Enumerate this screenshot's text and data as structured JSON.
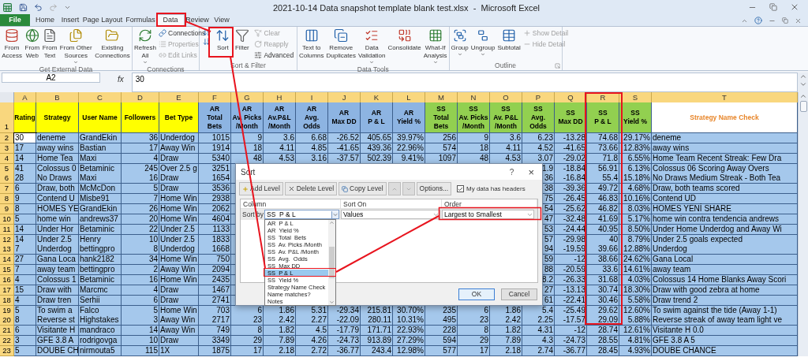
{
  "window": {
    "title": "2021-10-14 Data snapshot template blank test.xlsx  -  Microsoft Excel"
  },
  "tabs": [
    {
      "label": "File",
      "kind": "file",
      "selected": false
    },
    {
      "label": "Home",
      "kind": "tab",
      "selected": false
    },
    {
      "label": "Insert",
      "kind": "tab",
      "selected": false
    },
    {
      "label": "Page Layout",
      "kind": "tab",
      "selected": false
    },
    {
      "label": "Formulas",
      "kind": "tab",
      "selected": false
    },
    {
      "label": "Data",
      "kind": "tab",
      "selected": true
    },
    {
      "label": "Review",
      "kind": "tab",
      "selected": false
    },
    {
      "label": "View",
      "kind": "tab",
      "selected": false
    }
  ],
  "ribbon": {
    "groups": [
      {
        "label": "Get External Data",
        "items": [
          {
            "kind": "large",
            "label": [
              "From",
              "Access"
            ]
          },
          {
            "kind": "large",
            "label": [
              "From",
              "Web"
            ]
          },
          {
            "kind": "large",
            "label": [
              "From",
              "Text"
            ]
          },
          {
            "kind": "large",
            "label": [
              "From Other",
              "Sources"
            ],
            "dropdown": true
          },
          {
            "kind": "large",
            "label": [
              "Existing",
              "Connections"
            ]
          }
        ]
      },
      {
        "label": "Connections",
        "items": [
          {
            "kind": "large",
            "label": [
              "Refresh",
              "All"
            ],
            "dropdown": true
          },
          {
            "kind": "small",
            "label": "Connections",
            "disabled": false
          },
          {
            "kind": "small",
            "label": "Properties",
            "disabled": true
          },
          {
            "kind": "small",
            "label": "Edit Links",
            "disabled": true
          }
        ]
      },
      {
        "label": "Sort & Filter",
        "items": [
          {
            "kind": "icon",
            "disabled": false
          },
          {
            "kind": "icon",
            "disabled": false
          },
          {
            "kind": "large",
            "label": [
              "Sort"
            ]
          },
          {
            "kind": "large",
            "label": [
              "Filter"
            ]
          },
          {
            "kind": "small",
            "label": "Clear",
            "disabled": true
          },
          {
            "kind": "small",
            "label": "Reapply",
            "disabled": true
          },
          {
            "kind": "small",
            "label": "Advanced",
            "disabled": false
          }
        ]
      },
      {
        "label": "Data Tools",
        "items": [
          {
            "kind": "large",
            "label": [
              "Text to",
              "Columns"
            ]
          },
          {
            "kind": "large",
            "label": [
              "Remove",
              "Duplicates"
            ]
          },
          {
            "kind": "large",
            "label": [
              "Data",
              "Validation"
            ],
            "dropdown": true
          },
          {
            "kind": "large",
            "label": [
              "Consolidate"
            ]
          },
          {
            "kind": "large",
            "label": [
              "What-If",
              "Analysis"
            ],
            "dropdown": true
          }
        ]
      },
      {
        "label": "Outline",
        "launcher": true,
        "items": [
          {
            "kind": "large",
            "label": [
              "Group"
            ],
            "dropdown": true
          },
          {
            "kind": "large",
            "label": [
              "Ungroup"
            ],
            "dropdown": true
          },
          {
            "kind": "large",
            "label": [
              "Subtotal"
            ]
          },
          {
            "kind": "small",
            "label": "Show Detail",
            "disabled": true
          },
          {
            "kind": "small",
            "label": "Hide Detail",
            "disabled": true
          }
        ]
      }
    ]
  },
  "formula_bar": {
    "name_box": "A2",
    "fx": "fx",
    "value": "30"
  },
  "sheet": {
    "header_row_number": "1",
    "columns": [
      {
        "letter": "A",
        "header": [
          "Rating"
        ],
        "kind": "label"
      },
      {
        "letter": "B",
        "header": [
          "Strategy"
        ],
        "kind": "label"
      },
      {
        "letter": "C",
        "header": [
          "User Name"
        ],
        "kind": "label"
      },
      {
        "letter": "D",
        "header": [
          "Followers"
        ],
        "kind": "count"
      },
      {
        "letter": "E",
        "header": [
          "Bet Type"
        ],
        "kind": "label"
      },
      {
        "letter": "F",
        "header": [
          "AR",
          "Total",
          "Bets"
        ],
        "kind": "ar"
      },
      {
        "letter": "G",
        "header": [
          "AR",
          "Av. Picks",
          "/Month"
        ],
        "kind": "ar"
      },
      {
        "letter": "H",
        "header": [
          "AR",
          "Av.P&L",
          "/Month"
        ],
        "kind": "ar"
      },
      {
        "letter": "I",
        "header": [
          "AR",
          "Avg.",
          "Odds"
        ],
        "kind": "ar"
      },
      {
        "letter": "J",
        "header": [
          "AR",
          "Max DD"
        ],
        "kind": "ar"
      },
      {
        "letter": "K",
        "header": [
          "AR",
          "P & L"
        ],
        "kind": "ar"
      },
      {
        "letter": "L",
        "header": [
          "AR",
          "Yield %"
        ],
        "kind": "ar"
      },
      {
        "letter": "M",
        "header": [
          "SS",
          "Total",
          "Bets"
        ],
        "kind": "ss"
      },
      {
        "letter": "N",
        "header": [
          "SS",
          "Av. Picks",
          "/Month"
        ],
        "kind": "ss"
      },
      {
        "letter": "O",
        "header": [
          "SS",
          "Av. P&L",
          "/Month"
        ],
        "kind": "ss"
      },
      {
        "letter": "P",
        "header": [
          "SS",
          "Avg.",
          "Odds"
        ],
        "kind": "ss"
      },
      {
        "letter": "Q",
        "header": [
          "SS",
          "Max DD"
        ],
        "kind": "ss"
      },
      {
        "letter": "R",
        "header": [
          "SS",
          "P & L"
        ],
        "kind": "ss"
      },
      {
        "letter": "S",
        "header": [
          "SS",
          "Yield %"
        ],
        "kind": "ss"
      },
      {
        "letter": "T",
        "header": [
          "Strategy Name Check"
        ],
        "kind": "check"
      }
    ],
    "rows": [
      {
        "number": "2",
        "cells": [
          "30",
          "deneme",
          "GrandEkin",
          "36",
          "Underdog",
          "1015",
          "9",
          "3.6",
          "6.68",
          "-26.52",
          "405.65",
          "39.97%",
          "256",
          "9",
          "3.6",
          "6.23",
          "-13.28",
          "74.68",
          "29.17%",
          "deneme"
        ]
      },
      {
        "number": "3",
        "cells": [
          "17",
          "away wins",
          "Bastian",
          "17",
          "Away Win",
          "1914",
          "18",
          "4.11",
          "4.85",
          "-41.65",
          "439.36",
          "22.96%",
          "574",
          "18",
          "4.11",
          "4.52",
          "-41.65",
          "73.66",
          "12.83%",
          "away wins"
        ]
      },
      {
        "number": "4",
        "cells": [
          "14",
          "Home Tea",
          "Maxi",
          "4",
          "Draw",
          "5340",
          "48",
          "4.53",
          "3.16",
          "-37.57",
          "502.39",
          "9.41%",
          "1097",
          "48",
          "4.53",
          "3.07",
          "-29.02",
          "71.8",
          "6.55%",
          "Home Team Recent Streak: Few Dra"
        ]
      },
      {
        "number": "5",
        "cells": [
          "41",
          "Colossus 0",
          "Betaminic",
          "245",
          "Over 2.5 g",
          "3251",
          null,
          null,
          null,
          null,
          null,
          null,
          null,
          null,
          null,
          "1.9",
          "-18.84",
          "56.91",
          "6.13%",
          "Colossus 06 Scoring Away Overs"
        ]
      },
      {
        "number": "6",
        "cells": [
          "28",
          "No Draws",
          "Maxi",
          "16",
          "Draw",
          "1654",
          null,
          null,
          null,
          null,
          null,
          null,
          null,
          null,
          null,
          "36",
          "-16.84",
          "55.4",
          "15.18%",
          "No Draws Medium Streak - Both Tea"
        ]
      },
      {
        "number": "7",
        "cells": [
          "6",
          "Draw, both",
          "McMcDon",
          "5",
          "Draw",
          "3536",
          null,
          null,
          null,
          null,
          null,
          null,
          null,
          null,
          null,
          "38",
          "-39.36",
          "49.72",
          "4.68%",
          "Draw, both teams scored"
        ]
      },
      {
        "number": "8",
        "cells": [
          "9",
          "Contend U",
          "Misbe91",
          "7",
          "Home Win",
          "2938",
          null,
          null,
          null,
          null,
          null,
          null,
          null,
          null,
          null,
          "75",
          "-26.45",
          "46.83",
          "10.16%",
          "Contend UD"
        ]
      },
      {
        "number": "9",
        "cells": [
          "8",
          "HOMES YE",
          "GrandEkin",
          "26",
          "Home Win",
          "2062",
          null,
          null,
          null,
          null,
          null,
          null,
          null,
          null,
          null,
          "54",
          "-25.62",
          "46.82",
          "8.03%",
          "HOMES YENİ SHARE"
        ]
      },
      {
        "number": "10",
        "cells": [
          "5",
          "home win",
          "andrews37",
          "20",
          "Home Win",
          "4604",
          null,
          null,
          null,
          null,
          null,
          null,
          null,
          null,
          null,
          "47",
          "-32.48",
          "41.69",
          "5.17%",
          "home win contra tendencia andrews"
        ]
      },
      {
        "number": "11",
        "cells": [
          "14",
          "Under Hor",
          "Betaminic",
          "22",
          "Under 2.5",
          "1133",
          null,
          null,
          null,
          null,
          null,
          null,
          null,
          null,
          null,
          "53",
          "-24.44",
          "40.95",
          "8.50%",
          "Under Home Underdog and Away Wi"
        ]
      },
      {
        "number": "12",
        "cells": [
          "14",
          "Under 2.5",
          "Henry",
          "10",
          "Under 2.5",
          "1833",
          null,
          null,
          null,
          null,
          null,
          null,
          null,
          null,
          null,
          "57",
          "-29.98",
          "40",
          "8.79%",
          "Under 2.5 goals expected"
        ]
      },
      {
        "number": "13",
        "cells": [
          "7",
          "Underdog",
          "bettingpro",
          "8",
          "Underdog",
          "1668",
          null,
          null,
          null,
          null,
          null,
          null,
          null,
          null,
          null,
          "94",
          "-19.59",
          "39.66",
          "12.88%",
          "Underdog"
        ]
      },
      {
        "number": "14",
        "cells": [
          "27",
          "Gana Loca",
          "hank2182",
          "34",
          "Home Win",
          "750",
          null,
          null,
          null,
          null,
          null,
          null,
          null,
          null,
          null,
          "59",
          "-12",
          "38.66",
          "24.62%",
          "Gana Local"
        ]
      },
      {
        "number": "15",
        "cells": [
          "7",
          "away team",
          "bettingpro",
          "2",
          "Away Win",
          "2094",
          null,
          null,
          null,
          null,
          null,
          null,
          null,
          null,
          null,
          "88",
          "-20.59",
          "33.6",
          "14.61%",
          "away team"
        ]
      },
      {
        "number": "16",
        "cells": [
          "4",
          "Colossus 1",
          "Betaminic",
          "16",
          "Home Win",
          "2435",
          null,
          null,
          null,
          null,
          null,
          null,
          null,
          null,
          null,
          "8.2",
          "-26.33",
          "31.68",
          "4.03%",
          "Colossus 14 Home Blanks Away Scori"
        ]
      },
      {
        "number": "17",
        "cells": [
          "15",
          "Draw with",
          "Marcmc",
          "4",
          "Draw",
          "1467",
          null,
          null,
          null,
          null,
          null,
          null,
          null,
          null,
          null,
          "27",
          "-13.13",
          "30.74",
          "18.30%",
          "Draw with good zebra at home"
        ]
      },
      {
        "number": "18",
        "cells": [
          "4",
          "Draw tren",
          "Serhii",
          "6",
          "Draw",
          "2741",
          null,
          null,
          null,
          null,
          null,
          null,
          null,
          null,
          null,
          "61",
          "-22.41",
          "30.46",
          "5.58%",
          "Draw trend 2"
        ]
      },
      {
        "number": "19",
        "cells": [
          "5",
          "To swim a",
          "Falco",
          "5",
          "Home Win",
          "703",
          "6",
          "1.86",
          "5.31",
          "-29.34",
          "215.81",
          "30.70%",
          "235",
          "6",
          "1.86",
          "5.4",
          "-25.49",
          "29.62",
          "12.60%",
          "To swim against the tide (Away 1-1)"
        ]
      },
      {
        "number": "20",
        "cells": [
          "8",
          "Reverse st",
          "Highstakes",
          "3",
          "Away Win",
          "2717",
          "23",
          "2.42",
          "2.27",
          "-22.09",
          "280.11",
          "10.31%",
          "495",
          "23",
          "2.42",
          "2.25",
          "-17.57",
          "29.09",
          "5.88%",
          "Reverse streak of away team light ve"
        ]
      },
      {
        "number": "21",
        "cells": [
          "6",
          "Visitante H",
          "mandraco",
          "14",
          "Away Win",
          "749",
          "8",
          "1.82",
          "4.5",
          "-17.79",
          "171.71",
          "22.93%",
          "228",
          "8",
          "1.82",
          "4.31",
          "-12",
          "28.74",
          "12.61%",
          "Visitante H 0.0"
        ]
      },
      {
        "number": "22",
        "cells": [
          "3",
          "GFE 3.8 A",
          "rodrigovga",
          "10",
          "Draw",
          "3349",
          "29",
          "7.89",
          "4.26",
          "-24.73",
          "913.89",
          "27.29%",
          "594",
          "29",
          "7.89",
          "4.3",
          "-24.73",
          "28.55",
          "4.81%",
          "GFE 3.8 A 5"
        ]
      },
      {
        "number": "23",
        "cells": [
          "5",
          "DOUBE CH",
          "nirmouta5",
          "115",
          "1X",
          "1875",
          "17",
          "2.18",
          "2.72",
          "-36.77",
          "243.4",
          "12.98%",
          "577",
          "17",
          "2.18",
          "2.74",
          "-36.77",
          "28.45",
          "4.93%",
          "DOUBE CHANCE"
        ]
      }
    ]
  },
  "sort_dialog": {
    "title": "Sort",
    "help": "?",
    "close": "×",
    "toolbar": [
      {
        "kind": "add",
        "label": "Add Level",
        "disabled": false
      },
      {
        "kind": "delete",
        "label": "Delete Level",
        "disabled": false
      },
      {
        "kind": "copy",
        "label": "Copy Level",
        "disabled": false
      },
      {
        "kind": "up",
        "disabled": true
      },
      {
        "kind": "down",
        "disabled": true
      },
      {
        "kind": "text",
        "label": "Options...",
        "disabled": false
      }
    ],
    "headers_checkbox": {
      "label": "My data has headers",
      "checked": true
    },
    "column_headers": [
      "Column",
      "Sort On",
      "Order"
    ],
    "level": {
      "label": "Sort by",
      "column": "SS  P & L",
      "sort_on": "Values",
      "order": "Largest to Smallest"
    },
    "column_list": [
      {
        "label": "AR  P & L",
        "selected": false
      },
      {
        "label": "AR  Yield %",
        "selected": false
      },
      {
        "label": "SS  Total  Bets",
        "selected": false
      },
      {
        "label": "SS  Av. Picks /Month",
        "selected": false
      },
      {
        "label": "SS  Av. P&L /Month",
        "selected": false
      },
      {
        "label": "SS  Avg.  Odds",
        "selected": false
      },
      {
        "label": "SS  Max DD",
        "selected": false
      },
      {
        "label": "SS  P & L",
        "selected": true
      },
      {
        "label": "SS  Yield %",
        "selected": false
      },
      {
        "label": "Strategy Name Check",
        "selected": false
      },
      {
        "label": "Name matches?",
        "selected": false
      },
      {
        "label": "Notes",
        "selected": false
      }
    ],
    "buttons": [
      {
        "label": "OK",
        "default": true
      },
      {
        "label": "Cancel",
        "default": false
      }
    ]
  }
}
